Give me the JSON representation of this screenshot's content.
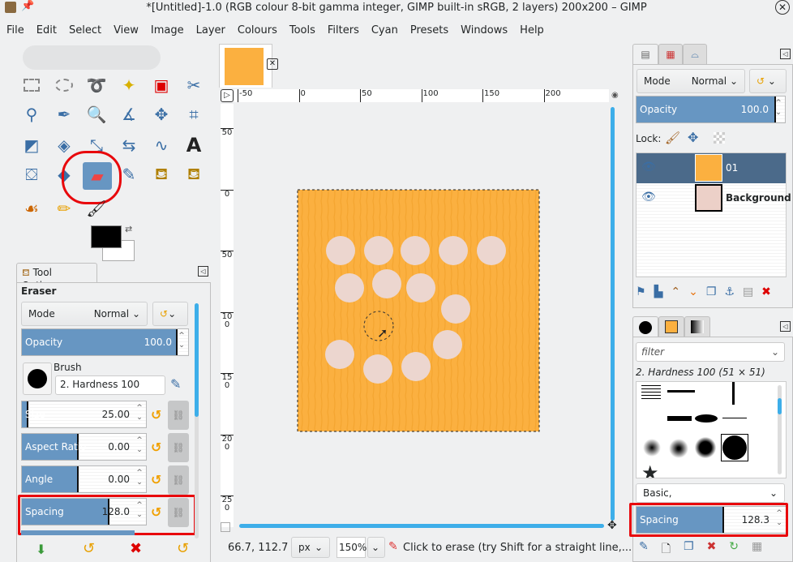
{
  "window": {
    "title": "*[Untitled]-1.0 (RGB colour 8-bit gamma integer, GIMP built-in sRGB, 2 layers) 200x200 – GIMP"
  },
  "menu": [
    "File",
    "Edit",
    "Select",
    "View",
    "Image",
    "Layer",
    "Colours",
    "Tools",
    "Filters",
    "Cyan",
    "Presets",
    "Windows",
    "Help"
  ],
  "toolbox": {
    "active_tool": "eraser",
    "fg_color": "#000000",
    "bg_color": "#ffffff"
  },
  "tool_options": {
    "tab_label": "Tool Options",
    "tool_name": "Eraser",
    "mode_label": "Mode",
    "mode_value": "Normal",
    "opacity": {
      "label": "Opacity",
      "value": "100.0",
      "fraction": 1.0
    },
    "brush_label": "Brush",
    "brush_value": "2. Hardness 100",
    "size": {
      "label": "Size",
      "value": "25.00",
      "fraction": 0.05
    },
    "aspect": {
      "label": "Aspect Ratio",
      "value": "0.00",
      "fraction": 0.5
    },
    "angle": {
      "label": "Angle",
      "value": "0.00",
      "fraction": 0.5
    },
    "spacing": {
      "label": "Spacing",
      "value": "128.0",
      "fraction": 0.64
    }
  },
  "canvas": {
    "ruler_h": [
      "-50",
      "0",
      "50",
      "100",
      "150",
      "200"
    ],
    "ruler_v": [
      "-50",
      "0",
      "50",
      "100",
      "150",
      "200",
      "250"
    ],
    "coords": "66.7, 112.7",
    "unit": "px",
    "zoom": "150%",
    "status_message": "Click to erase (try Shift for a straight line,...",
    "image_color": "#fbb040"
  },
  "layers": {
    "mode_label": "Mode",
    "mode_value": "Normal",
    "opacity": {
      "label": "Opacity",
      "value": "100.0",
      "fraction": 1.0
    },
    "lock_label": "Lock:",
    "items": [
      {
        "name": "01",
        "selected": true,
        "visible": true
      },
      {
        "name": "Background",
        "selected": false,
        "visible": true
      }
    ]
  },
  "brushes": {
    "filter_placeholder": "filter",
    "selected_brush": "2. Hardness 100 (51 × 51)",
    "tag_value": "Basic,",
    "spacing": {
      "label": "Spacing",
      "value": "128.3",
      "fraction": 0.55
    }
  }
}
